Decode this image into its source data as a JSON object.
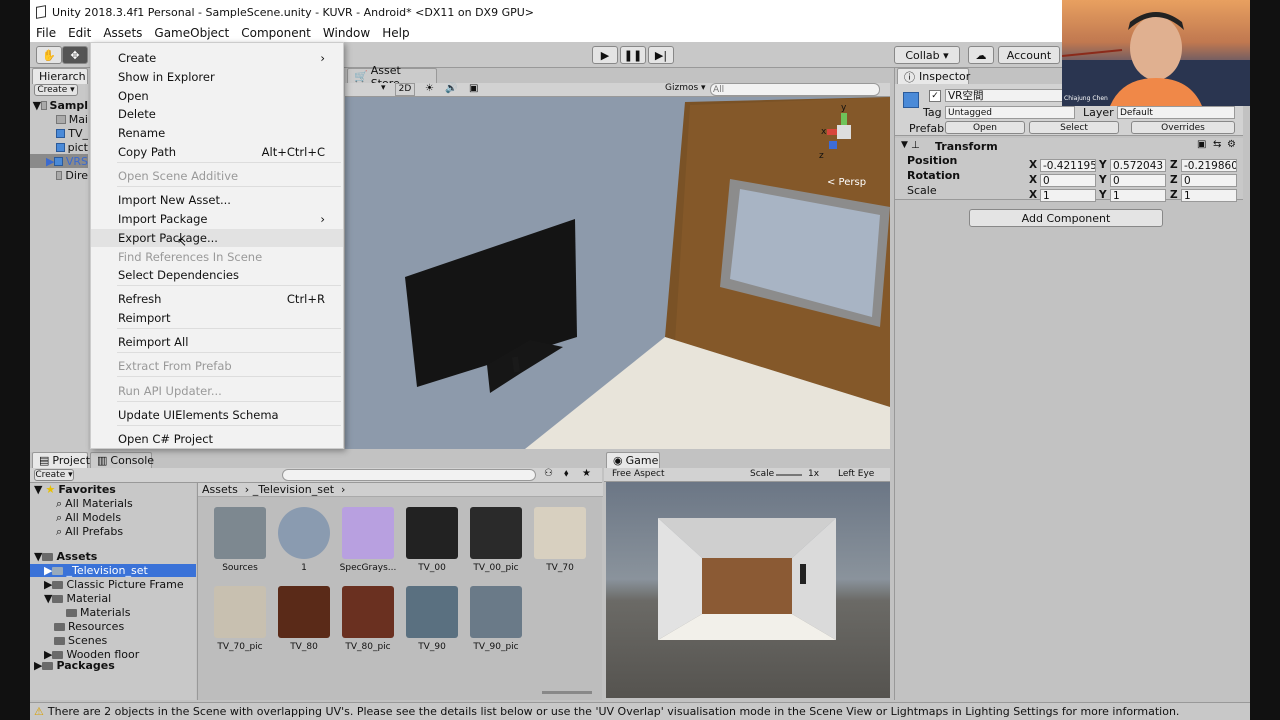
{
  "window_title": "Unity 2018.3.4f1 Personal - SampleScene.unity - KUVR - Android* <DX11 on DX9 GPU>",
  "menubar": [
    "File",
    "Edit",
    "Assets",
    "GameObject",
    "Component",
    "Window",
    "Help"
  ],
  "toolbar": {
    "collab": "Collab ▾",
    "account": "Account"
  },
  "hierarchy": {
    "tab": "Hierarch",
    "create": "Create ▾",
    "items": [
      "Sampl",
      "Mai",
      "TV_",
      "pict",
      "VRS",
      "Dire"
    ]
  },
  "scene": {
    "tab": "Asset Store",
    "mode": "2D",
    "gizmos": "Gizmos ▾",
    "search_placeholder": "All",
    "persp": "< Persp",
    "axis_y": "y",
    "axis_x": "x",
    "axis_z": "z"
  },
  "context_menu": {
    "items": [
      {
        "label": "Create",
        "shortcut": "",
        "disabled": false,
        "submenu": true
      },
      {
        "label": "Show in Explorer",
        "shortcut": "",
        "disabled": false
      },
      {
        "label": "Open",
        "shortcut": "",
        "disabled": false
      },
      {
        "label": "Delete",
        "shortcut": "",
        "disabled": false
      },
      {
        "label": "Rename",
        "shortcut": "",
        "disabled": false
      },
      {
        "label": "Copy Path",
        "shortcut": "Alt+Ctrl+C",
        "disabled": false
      },
      {
        "label": "Open Scene Additive",
        "shortcut": "",
        "disabled": true
      },
      {
        "label": "Import New Asset...",
        "shortcut": "",
        "disabled": false
      },
      {
        "label": "Import Package",
        "shortcut": "",
        "disabled": false,
        "submenu": true
      },
      {
        "label": "Export Package...",
        "shortcut": "",
        "disabled": false,
        "highlighted": true
      },
      {
        "label": "Find References In Scene",
        "shortcut": "",
        "disabled": true
      },
      {
        "label": "Select Dependencies",
        "shortcut": "",
        "disabled": false
      },
      {
        "label": "Refresh",
        "shortcut": "Ctrl+R",
        "disabled": false
      },
      {
        "label": "Reimport",
        "shortcut": "",
        "disabled": false
      },
      {
        "label": "Reimport All",
        "shortcut": "",
        "disabled": false
      },
      {
        "label": "Extract From Prefab",
        "shortcut": "",
        "disabled": true
      },
      {
        "label": "Run API Updater...",
        "shortcut": "",
        "disabled": true
      },
      {
        "label": "Update UIElements Schema",
        "shortcut": "",
        "disabled": false
      },
      {
        "label": "Open C# Project",
        "shortcut": "",
        "disabled": false
      }
    ]
  },
  "inspector": {
    "tab": "Inspector",
    "object_name": "VR空間",
    "tag_label": "Tag",
    "tag_value": "Untagged",
    "layer_label": "Layer",
    "layer_value": "Default",
    "prefab_label": "Prefab",
    "prefab_open": "Open",
    "prefab_select": "Select",
    "prefab_overrides": "Overrides",
    "transform_title": "Transform",
    "position_label": "Position",
    "position": {
      "x": "-0.421195",
      "y": "0.572043",
      "z": "-0.219860"
    },
    "rotation_label": "Rotation",
    "rotation": {
      "x": "0",
      "y": "0",
      "z": "0"
    },
    "scale_label": "Scale",
    "scale": {
      "x": "1",
      "y": "1",
      "z": "1"
    },
    "add_component": "Add Component"
  },
  "project": {
    "tab_project": "Project",
    "tab_console": "Console",
    "create": "Create ▾",
    "favorites_label": "Favorites",
    "favorites": [
      "All Materials",
      "All Models",
      "All Prefabs"
    ],
    "assets_label": "Assets",
    "assets_tree": [
      "_Television_set",
      "Classic Picture Frame",
      "Material",
      "Materials",
      "Resources",
      "Scenes",
      "Wooden floor"
    ],
    "packages_label": "Packages",
    "breadcrumb": [
      "Assets",
      "_Television_set"
    ],
    "files": [
      "Sources",
      "1",
      "SpecGrays...",
      "TV_00",
      "TV_00_pic",
      "TV_70",
      "TV_70_pic",
      "TV_80",
      "TV_80_pic",
      "TV_90",
      "TV_90_pic"
    ]
  },
  "game": {
    "tab": "Game",
    "aspect": "Free Aspect",
    "scale_label": "Scale",
    "scale_value": "1x",
    "eye": "Left Eye"
  },
  "status_text": "There are 2 objects in the Scene with overlapping UV's. Please see the details list below or use the 'UV Overlap' visualisation mode in the Scene View or Lightmaps in Lighting Settings for more information.",
  "webcam_name": "Chiajung Chen"
}
